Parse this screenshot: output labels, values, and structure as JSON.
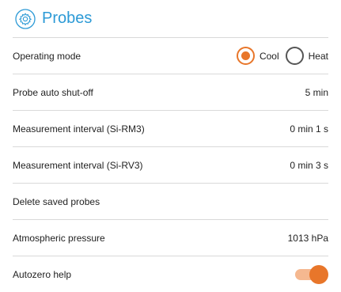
{
  "header": {
    "title": "Probes",
    "icon": "gear-icon",
    "accent_color": "#2c9ad6"
  },
  "settings": {
    "operating_mode": {
      "label": "Operating mode",
      "options": [
        {
          "label": "Cool",
          "checked": true
        },
        {
          "label": "Heat",
          "checked": false
        }
      ],
      "selected_color": "#e8762a"
    },
    "probe_auto_shutoff": {
      "label": "Probe auto shut-off",
      "value": "5 min"
    },
    "interval_rm3": {
      "label": "Measurement interval (Si-RM3)",
      "value": "0 min 1 s"
    },
    "interval_rv3": {
      "label": "Measurement interval (Si-RV3)",
      "value": "0 min 3 s"
    },
    "delete_saved_probes": {
      "label": "Delete saved probes"
    },
    "atmospheric_pressure": {
      "label": "Atmospheric pressure",
      "value": "1013 hPa"
    },
    "autozero_help": {
      "label": "Autozero help",
      "enabled": true
    }
  }
}
